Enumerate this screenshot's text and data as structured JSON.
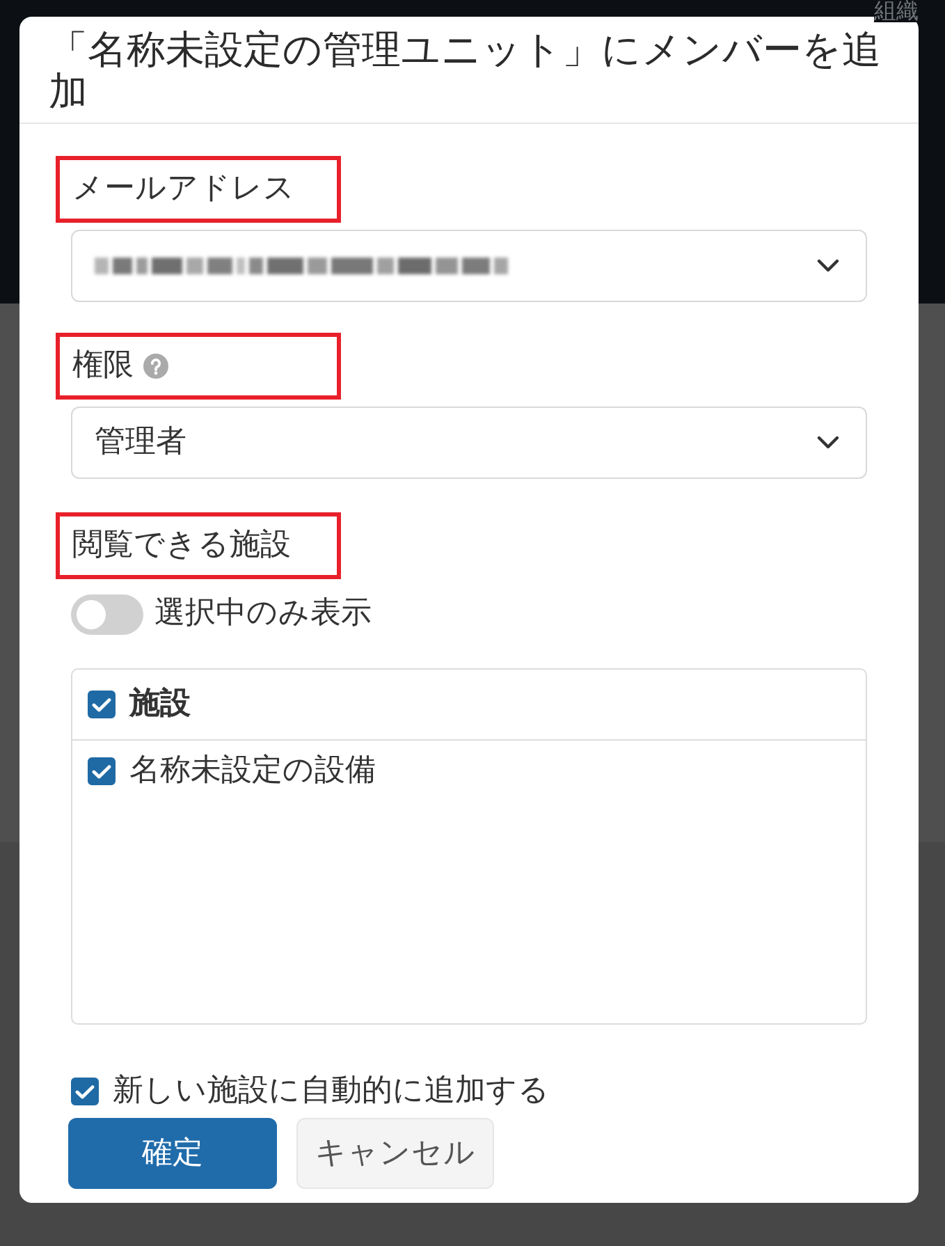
{
  "background": {
    "header_text": "組織"
  },
  "dialog": {
    "title": "「名称未設定の管理ユニット」にメンバーを追加",
    "fields": [
      {
        "label": "メールアドレス",
        "highlighted": true,
        "help": false,
        "redacted": true
      },
      {
        "label": "権限",
        "highlighted": true,
        "help": true,
        "redacted": false,
        "value": "管理者"
      }
    ],
    "facilities": {
      "label": "閲覧できる施設",
      "highlighted": true,
      "toggle": {
        "label": "選択中のみ表示",
        "on": false
      },
      "header": {
        "label": "施設",
        "checked": true
      },
      "items": [
        {
          "label": "名称未設定の設備",
          "checked": true
        }
      ]
    },
    "auto_add": {
      "label": "新しい施設に自動的に追加する",
      "checked": true
    },
    "buttons": [
      {
        "label": "確定",
        "kind": "primary"
      },
      {
        "label": "キャンセル",
        "kind": "secondary"
      }
    ]
  }
}
